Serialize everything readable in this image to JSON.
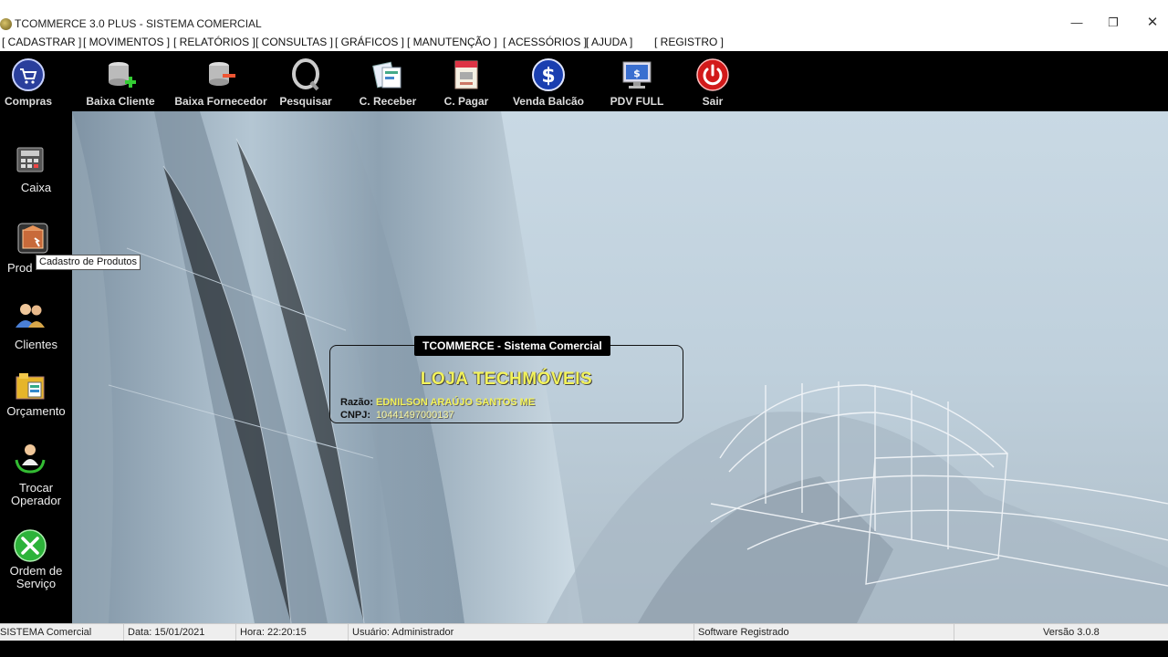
{
  "window": {
    "title": "TCOMMERCE 3.0 PLUS - SISTEMA COMERCIAL",
    "min": "—",
    "max": "❐",
    "close": "✕"
  },
  "menu": [
    "[ CADASTRAR ]",
    "[ MOVIMENTOS ]",
    "[ RELATÓRIOS ]",
    "[ CONSULTAS ]",
    "[ GRÁFICOS ]",
    "[ MANUTENÇÃO ]",
    "[ ACESSÓRIOS ]",
    "[ AJUDA ]",
    "[ REGISTRO ]"
  ],
  "toolbar": [
    {
      "label": "Compras",
      "icon": "cart-icon"
    },
    {
      "label": "Baixa Cliente",
      "icon": "database-add-icon"
    },
    {
      "label": "Baixa Fornecedor",
      "icon": "database-remove-icon"
    },
    {
      "label": "Pesquisar",
      "icon": "search-icon"
    },
    {
      "label": "C. Receber",
      "icon": "receivable-icon"
    },
    {
      "label": "C. Pagar",
      "icon": "payable-icon"
    },
    {
      "label": "Venda Balcão",
      "icon": "dollar-icon"
    },
    {
      "label": "PDV FULL",
      "icon": "monitor-icon"
    },
    {
      "label": "Sair",
      "icon": "power-icon"
    }
  ],
  "sidebar": {
    "caixa": "Caixa",
    "produtos": "Prod",
    "clientes": "Clientes",
    "orcamento": "Orçamento",
    "trocar1": "Trocar",
    "trocar2": "Operador",
    "ordem1": "Ordem de",
    "ordem2": "Serviço"
  },
  "tooltip": "Cadastro de Produtos",
  "info": {
    "panel_title": "TCOMMERCE - Sistema Comercial",
    "store_name": "LOJA TECHMÓVEIS",
    "razao_label": "Razão:",
    "razao_value": "EDNILSON ARAÚJO SANTOS ME",
    "cnpj_label": "CNPJ:",
    "cnpj_value": "10441497000137"
  },
  "status": {
    "system": "SISTEMA Comercial",
    "date": "Data: 15/01/2021",
    "time": "Hora: 22:20:15",
    "user": "Usuário: Administrador",
    "license": "Software Registrado",
    "version": "Versão 3.0.8"
  },
  "colors": {
    "accent_yellow": "#f2f25a",
    "bar_black": "#000000"
  }
}
